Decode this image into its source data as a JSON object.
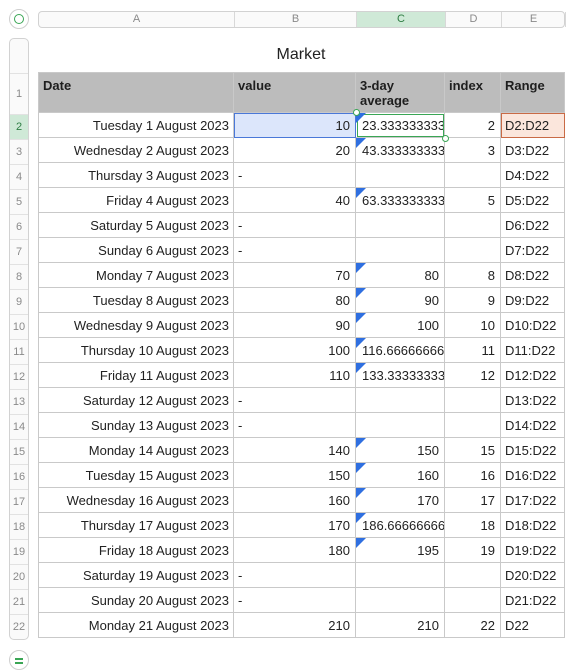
{
  "sheet": {
    "title": "Market"
  },
  "column_headers": [
    "A",
    "B",
    "C",
    "D",
    "E"
  ],
  "selected_column": "C",
  "selected_row": "2",
  "table": {
    "headers": [
      "Date",
      "value",
      "3-day average",
      "index",
      "Range"
    ],
    "rows": [
      {
        "row": "1",
        "date": "",
        "value": "",
        "avg": "",
        "index": "",
        "range": ""
      },
      {
        "row": "2",
        "date": "Tuesday 1 August 2023",
        "value": "10",
        "avg": "23.3333333333",
        "index": "2",
        "range": "D2:D22"
      },
      {
        "row": "3",
        "date": "Wednesday 2 August 2023",
        "value": "20",
        "avg": "43.3333333333",
        "index": "3",
        "range": "D3:D22"
      },
      {
        "row": "4",
        "date": "Thursday 3 August 2023",
        "value": "-",
        "avg": "",
        "index": "",
        "range": "D4:D22"
      },
      {
        "row": "5",
        "date": "Friday 4 August 2023",
        "value": "40",
        "avg": "63.3333333333",
        "index": "5",
        "range": "D5:D22"
      },
      {
        "row": "6",
        "date": "Saturday 5 August 2023",
        "value": "-",
        "avg": "",
        "index": "",
        "range": "D6:D22"
      },
      {
        "row": "7",
        "date": "Sunday 6 August 2023",
        "value": "-",
        "avg": "",
        "index": "",
        "range": "D7:D22"
      },
      {
        "row": "8",
        "date": "Monday 7 August 2023",
        "value": "70",
        "avg": "80",
        "index": "8",
        "range": "D8:D22"
      },
      {
        "row": "9",
        "date": "Tuesday 8 August 2023",
        "value": "80",
        "avg": "90",
        "index": "9",
        "range": "D9:D22"
      },
      {
        "row": "10",
        "date": "Wednesday 9 August 2023",
        "value": "90",
        "avg": "100",
        "index": "10",
        "range": "D10:D22"
      },
      {
        "row": "11",
        "date": "Thursday 10 August 2023",
        "value": "100",
        "avg": "116.666666666",
        "index": "11",
        "range": "D11:D22"
      },
      {
        "row": "12",
        "date": "Friday 11 August 2023",
        "value": "110",
        "avg": "133.333333333",
        "index": "12",
        "range": "D12:D22"
      },
      {
        "row": "13",
        "date": "Saturday 12 August 2023",
        "value": "-",
        "avg": "",
        "index": "",
        "range": "D13:D22"
      },
      {
        "row": "14",
        "date": "Sunday 13 August 2023",
        "value": "-",
        "avg": "",
        "index": "",
        "range": "D14:D22"
      },
      {
        "row": "15",
        "date": "Monday 14 August 2023",
        "value": "140",
        "avg": "150",
        "index": "15",
        "range": "D15:D22"
      },
      {
        "row": "16",
        "date": "Tuesday 15 August 2023",
        "value": "150",
        "avg": "160",
        "index": "16",
        "range": "D16:D22"
      },
      {
        "row": "17",
        "date": "Wednesday 16 August 2023",
        "value": "160",
        "avg": "170",
        "index": "17",
        "range": "D17:D22"
      },
      {
        "row": "18",
        "date": "Thursday 17 August 2023",
        "value": "170",
        "avg": "186.666666666",
        "index": "18",
        "range": "D18:D22"
      },
      {
        "row": "19",
        "date": "Friday 18 August 2023",
        "value": "180",
        "avg": "195",
        "index": "19",
        "range": "D19:D22"
      },
      {
        "row": "20",
        "date": "Saturday 19 August 2023",
        "value": "-",
        "avg": "",
        "index": "",
        "range": "D20:D22"
      },
      {
        "row": "21",
        "date": "Sunday 20 August 2023",
        "value": "-",
        "avg": "",
        "index": "",
        "range": "D21:D22"
      },
      {
        "row": "22",
        "date": "Monday 21 August 2023",
        "value": "210",
        "avg": "210",
        "index": "22",
        "range": "D22"
      }
    ],
    "formula_flag_rows": [
      "2",
      "3",
      "5",
      "8",
      "9",
      "10",
      "11",
      "12",
      "15",
      "16",
      "17",
      "18",
      "19"
    ]
  },
  "colors": {
    "selection_green": "#3aa655",
    "formula_flag": "#2f6fe0",
    "header_fill": "#bcbcbc"
  }
}
